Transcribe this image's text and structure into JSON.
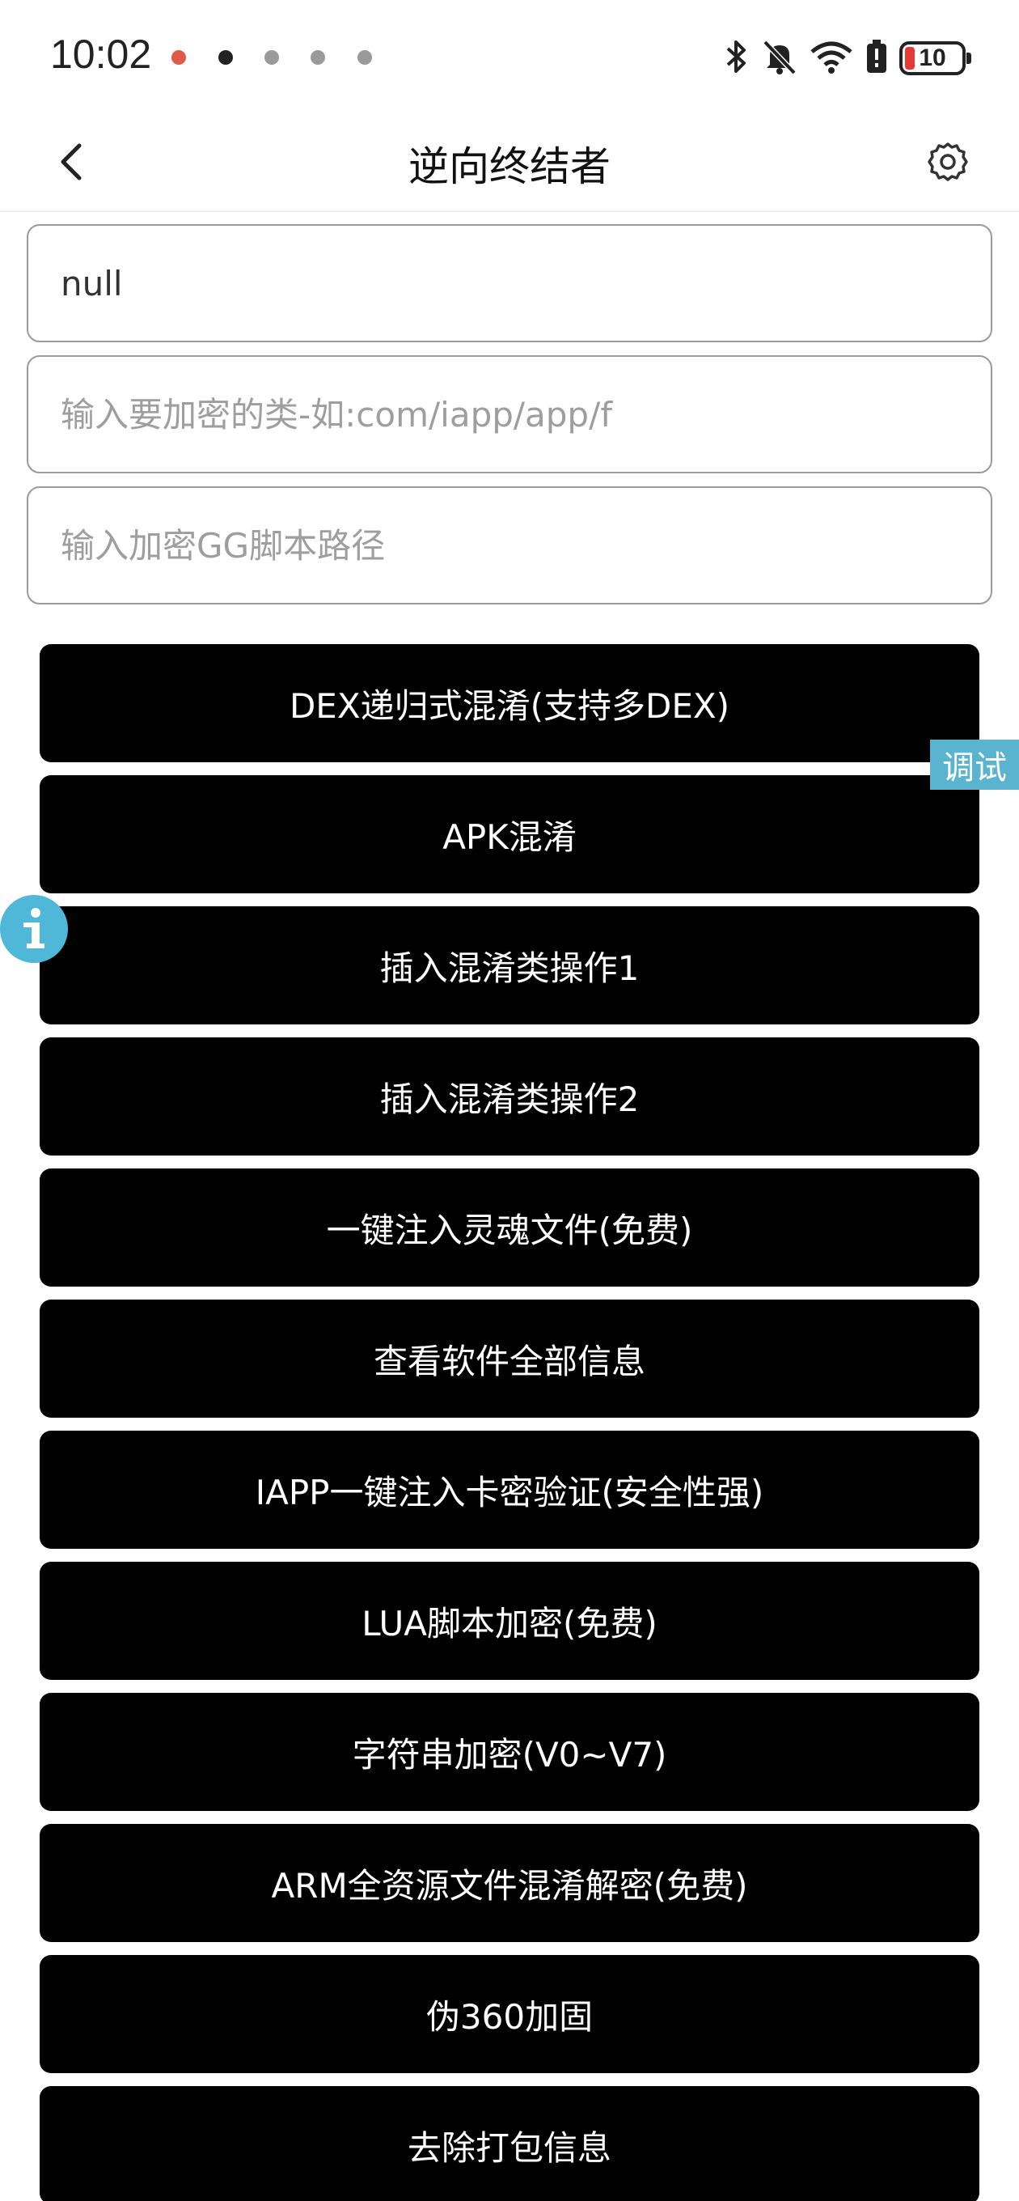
{
  "status_bar": {
    "time": "10:02",
    "battery_level": "10",
    "notification_dot_colors": [
      "#e05a4a",
      "#222222",
      "#9a9a9a",
      "#9a9a9a",
      "#9a9a9a"
    ],
    "icons": [
      "bluetooth-icon",
      "silent-bell-icon",
      "wifi-icon",
      "battery-saver-icon",
      "battery-icon"
    ]
  },
  "header": {
    "title": "逆向终结者",
    "back_icon": "chevron-left-icon",
    "settings_icon": "gear-icon"
  },
  "inputs": [
    {
      "value": "null",
      "placeholder": ""
    },
    {
      "value": "",
      "placeholder": "输入要加密的类-如:com/iapp/app/f"
    },
    {
      "value": "",
      "placeholder": "输入加密GG脚本路径"
    }
  ],
  "buttons": [
    "DEX递归式混淆(支持多DEX)",
    "APK混淆",
    "插入混淆类操作1",
    "插入混淆类操作2",
    "一键注入灵魂文件(免费)",
    "查看软件全部信息",
    "IAPP一键注入卡密验证(安全性强)",
    "LUA脚本加密(免费)",
    "字符串加密(V0~V7)",
    "ARM全资源文件混淆解密(免费)",
    "伪360加固",
    "去除打包信息"
  ],
  "floating": {
    "debug_label": "调试",
    "info_icon": "info-icon"
  },
  "colors": {
    "button_bg": "#000000",
    "button_text": "#ffffff",
    "accent": "#4fb8d8",
    "input_border": "#9a9a9a",
    "battery_low": "#e53935"
  }
}
